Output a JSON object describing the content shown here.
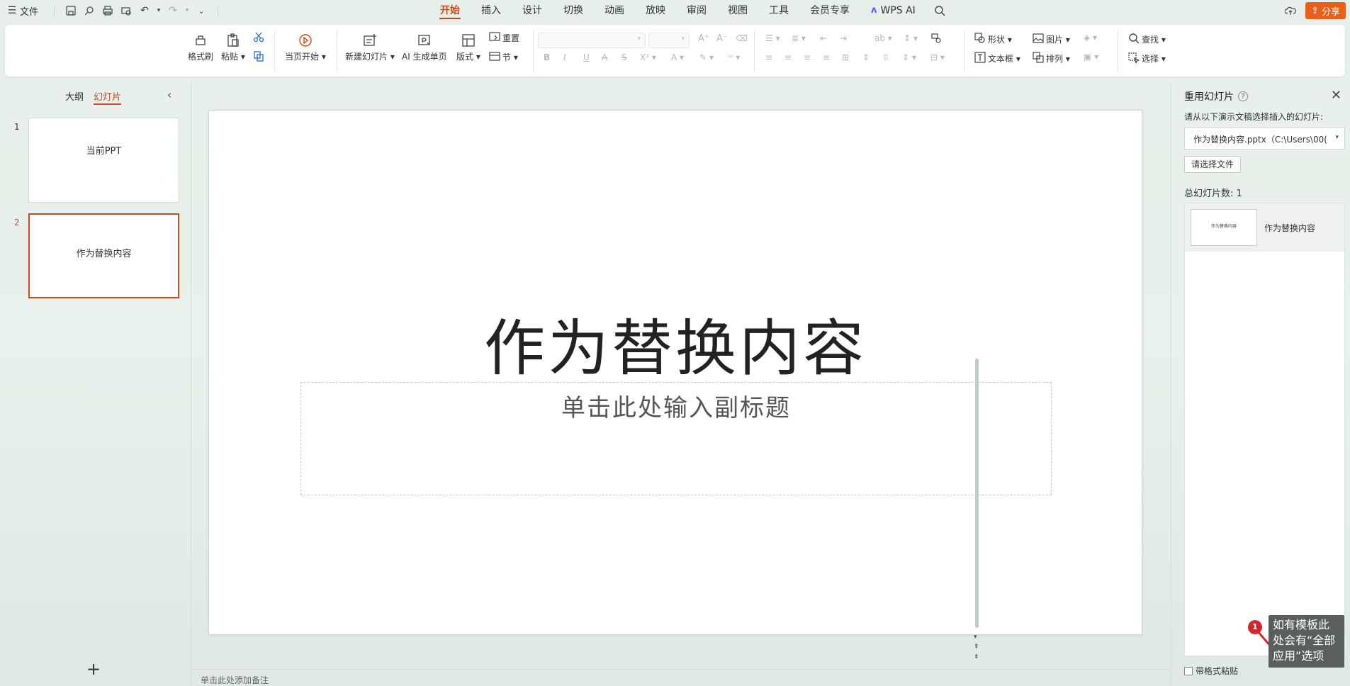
{
  "menubar": {
    "file_label": "文件",
    "tabs": [
      "开始",
      "插入",
      "设计",
      "切换",
      "动画",
      "放映",
      "审阅",
      "视图",
      "工具",
      "会员专享",
      "WPS AI"
    ],
    "share_label": "分享"
  },
  "ribbon": {
    "format_painter": "格式刷",
    "paste": "粘贴",
    "from_current": "当页开始",
    "new_slide": "新建幻灯片",
    "ai_single": "AI 生成单页",
    "layout": "版式",
    "reset": "重置",
    "section": "节",
    "shape": "形状",
    "picture": "图片",
    "find": "查找",
    "textbox": "文本框",
    "arrange": "排列",
    "select": "选择"
  },
  "left_panel": {
    "tab_outline": "大纲",
    "tab_slides": "幻灯片",
    "slides": [
      {
        "number": "1",
        "title": "当前PPT"
      },
      {
        "number": "2",
        "title": "作为替换内容"
      }
    ]
  },
  "slide": {
    "title": "作为替换内容",
    "subtitle": "单击此处输入副标题"
  },
  "notes": {
    "placeholder": "单击此处添加备注"
  },
  "right_panel": {
    "title": "重用幻灯片",
    "instruction": "请从以下演示文稿选择插入的幻灯片:",
    "file_value": "作为替换内容.pptx（C:\\Users\\00(",
    "browse_button": "请选择文件",
    "total_label": "总幻灯片数: 1",
    "items": [
      {
        "thumb_text": "作为替换内容",
        "label": "作为替换内容"
      }
    ],
    "keep_format_label": "带格式粘贴"
  },
  "annotation": {
    "badge": "1",
    "text": "如有模板此处会有“全部应用”选项"
  },
  "colors": {
    "accent": "#d0461a",
    "share": "#e8601c",
    "badge": "#d4272a"
  }
}
